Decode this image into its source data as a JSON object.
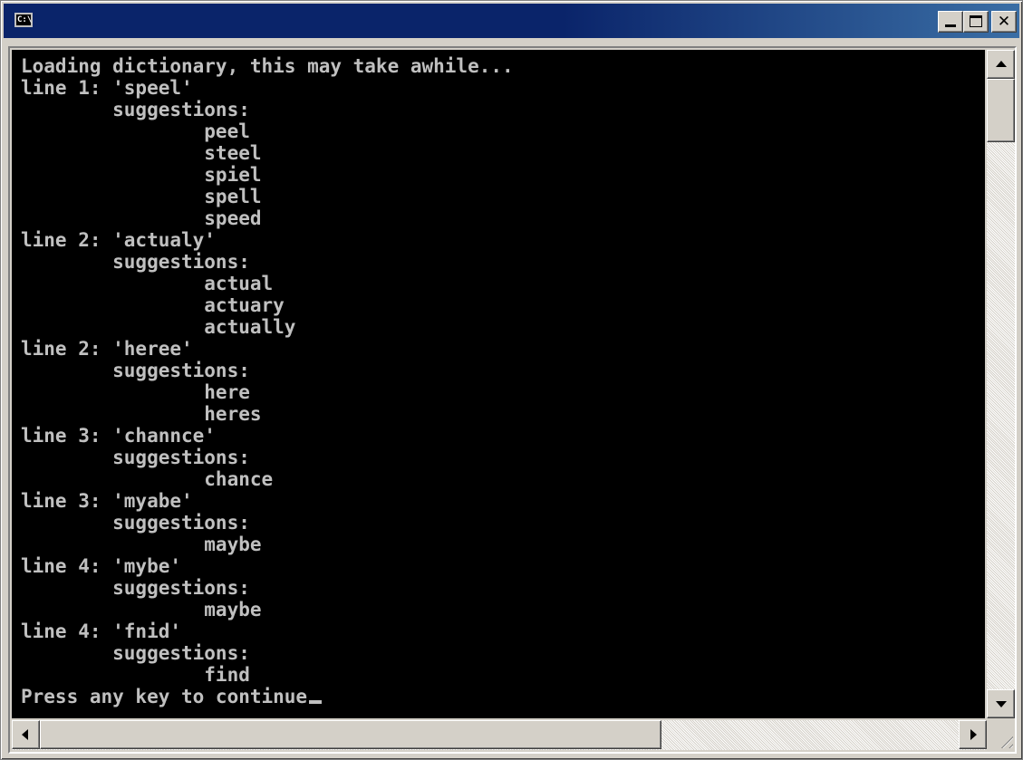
{
  "window": {
    "icon_text": "C:\\",
    "close_symbol": "✕"
  },
  "console": {
    "lines": [
      "Loading dictionary, this may take awhile...",
      "line 1: 'speel'",
      "        suggestions:",
      "                peel",
      "                steel",
      "                spiel",
      "                spell",
      "                speed",
      "line 2: 'actualy'",
      "        suggestions:",
      "                actual",
      "                actuary",
      "                actually",
      "line 2: 'heree'",
      "        suggestions:",
      "                here",
      "                heres",
      "line 3: 'channce'",
      "        suggestions:",
      "                chance",
      "line 3: 'myabe'",
      "        suggestions:",
      "                maybe",
      "line 4: 'mybe'",
      "        suggestions:",
      "                maybe",
      "line 4: 'fnid'",
      "        suggestions:",
      "                find",
      "Press any key to continue"
    ]
  },
  "colors": {
    "title_bar": "#0a246a",
    "console_bg": "#000000",
    "console_text": "#c0c0c0",
    "chrome": "#d4d0c8"
  },
  "icons": {
    "window_icon": "cmd-icon",
    "minimize": "minimize-icon",
    "maximize": "maximize-icon",
    "close": "close-icon",
    "scroll_up": "arrow-up-icon",
    "scroll_down": "arrow-down-icon",
    "scroll_left": "arrow-left-icon",
    "scroll_right": "arrow-right-icon",
    "resize_grip": "resize-grip-icon"
  }
}
